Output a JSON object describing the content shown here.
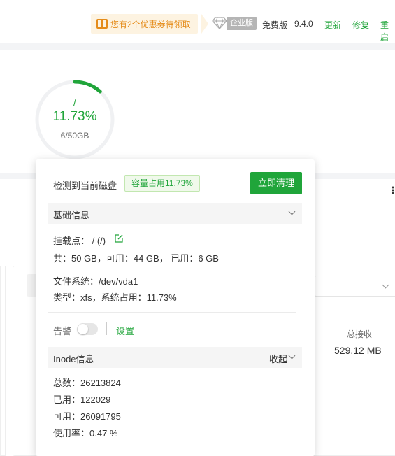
{
  "topbar": {
    "coupon_text": "您有2个优惠券待领取",
    "enterprise_label": "企业版",
    "free_label": "免费版",
    "version": "9.4.0",
    "update_label": "更新",
    "repair_label": "修复",
    "restart_label": "重启"
  },
  "disk_gauge": {
    "mount": "/",
    "percent_text": "11.73%",
    "usage_fraction": 0.1173,
    "size_text": "6/50GB",
    "accent_color": "#20a53a"
  },
  "traffic": {
    "total_recv_label": "总接收",
    "total_recv_value": "529.12 MB"
  },
  "popover": {
    "title": "检测到当前磁盘",
    "badge": "容量占用11.73%",
    "clean_button": "立即清理",
    "basic_section": {
      "title": "基础信息",
      "mount_point": "挂载点： / (/)",
      "capacity": "共：50 GB，可用：44 GB， 已用：6 GB",
      "filesystem": "文件系统：/dev/vda1",
      "type": "类型：xfs，系统占用：11.73%"
    },
    "alarm": {
      "label": "告警",
      "enabled": false,
      "settings_label": "设置"
    },
    "inode_section": {
      "title": "Inode信息",
      "collapse_label": "收起",
      "total": "总数：26213824",
      "used": "已用：122029",
      "available": "可用：26091795",
      "usage": "使用率：0.47 %"
    }
  }
}
